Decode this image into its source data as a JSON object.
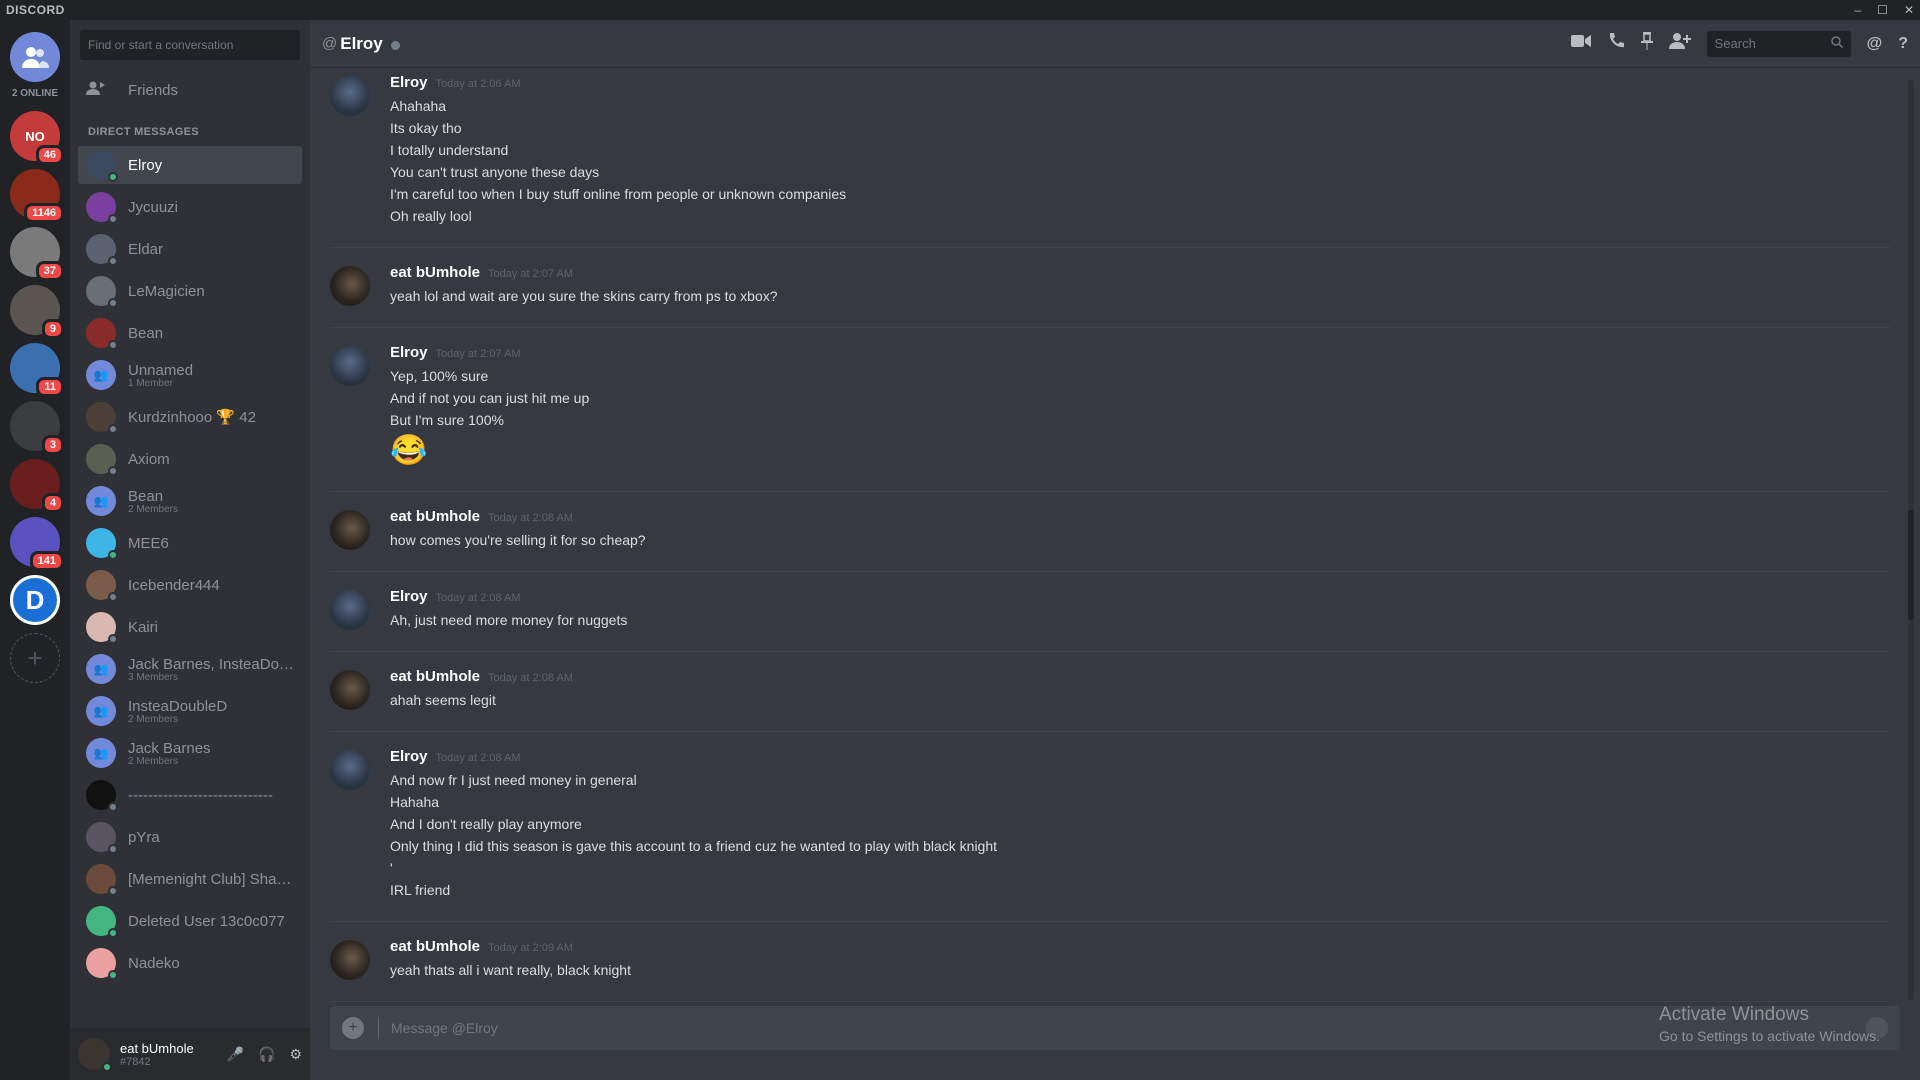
{
  "app": {
    "brand": "DISCORD"
  },
  "window": {
    "minimize": "–",
    "maximize": "☐",
    "close": "✕"
  },
  "guilds": {
    "online_count": "2 ONLINE",
    "items": [
      {
        "name": "Say No To Soy",
        "initials": "NO",
        "badge": "46",
        "color": "#c43b3b"
      },
      {
        "name": "red server",
        "initials": "",
        "badge": "1146",
        "color": "#8a2a1a"
      },
      {
        "name": "grey server",
        "initials": "",
        "badge": "37",
        "color": "#7a7a7a"
      },
      {
        "name": "photo server",
        "initials": "",
        "badge": "9",
        "color": "#5a5550"
      },
      {
        "name": "blue shoe server",
        "initials": "",
        "badge": "11",
        "color": "#3a6fb0"
      },
      {
        "name": "dark server",
        "initials": "",
        "badge": "3",
        "color": "#3a3c40"
      },
      {
        "name": "red logo server",
        "initials": "",
        "badge": "4",
        "color": "#6a1e1e"
      },
      {
        "name": "purple server",
        "initials": "",
        "badge": "141",
        "color": "#5a52c0"
      },
      {
        "name": "D server",
        "initials": "D",
        "badge": "",
        "color": "#1a6fd6"
      }
    ],
    "add_label": "+"
  },
  "dm_sidebar": {
    "search_placeholder": "Find or start a conversation",
    "friends_label": "Friends",
    "section_title": "DIRECT MESSAGES",
    "items": [
      {
        "name": "Elroy",
        "sub": "",
        "active": true,
        "color": "#3b4a5e"
      },
      {
        "name": "Jycuuzi",
        "sub": "",
        "active": false,
        "color": "#7b3fa0"
      },
      {
        "name": "Eldar",
        "sub": "",
        "active": false,
        "color": "#5b6170"
      },
      {
        "name": "LeMagicien",
        "sub": "",
        "active": false,
        "color": "#6a6e75"
      },
      {
        "name": "Bean",
        "sub": "",
        "active": false,
        "color": "#8a2b2b"
      },
      {
        "name": "Unnamed",
        "sub": "1 Member",
        "active": false,
        "color": "#7289da"
      },
      {
        "name": "Kurdzinhooo 🏆 42",
        "sub": "",
        "active": false,
        "color": "#4a4038"
      },
      {
        "name": "Axiom",
        "sub": "",
        "active": false,
        "color": "#5a5f52"
      },
      {
        "name": "Bean",
        "sub": "2 Members",
        "active": false,
        "color": "#7289da"
      },
      {
        "name": "MEE6",
        "sub": "",
        "active": false,
        "color": "#3fb5e6"
      },
      {
        "name": "Icebender444",
        "sub": "",
        "active": false,
        "color": "#7a5a48"
      },
      {
        "name": "Kairi",
        "sub": "",
        "active": false,
        "color": "#d8b8b0"
      },
      {
        "name": "Jack Barnes, InsteaDoub...",
        "sub": "3 Members",
        "active": false,
        "color": "#7289da"
      },
      {
        "name": "InsteaDoubleD",
        "sub": "2 Members",
        "active": false,
        "color": "#7289da"
      },
      {
        "name": "Jack Barnes",
        "sub": "2 Members",
        "active": false,
        "color": "#7289da"
      },
      {
        "name": "-----------------------------",
        "sub": "",
        "active": false,
        "color": "#111111"
      },
      {
        "name": "pYra",
        "sub": "",
        "active": false,
        "color": "#5a5560"
      },
      {
        "name": "[Memenight Club] Shai ...",
        "sub": "",
        "active": false,
        "color": "#6a4a3a"
      },
      {
        "name": "Deleted User 13c0c077",
        "sub": "",
        "active": false,
        "color": "#43b581"
      },
      {
        "name": "Nadeko",
        "sub": "",
        "active": false,
        "color": "#e8a0a0"
      }
    ]
  },
  "user_panel": {
    "username": "eat bUmhole",
    "discriminator": "#7842",
    "mic": "🎤",
    "headset": "🎧",
    "settings": "⚙"
  },
  "chat": {
    "at": "@",
    "title": "Elroy",
    "search_placeholder": "Search",
    "icons": {
      "video": "video-call-icon",
      "call": "voice-call-icon",
      "pin": "pin-icon",
      "add_user": "add-friend-icon",
      "mention": "@",
      "help": "?"
    },
    "messages": [
      {
        "author": "Elroy",
        "avatar": "elroy",
        "time": "Today at 2:06 AM",
        "lines": [
          "Ahahaha",
          "Its okay tho",
          "I totally understand",
          "You can't trust anyone these days",
          "I'm careful too when I buy stuff online from people or unknown companies",
          "Oh really lool"
        ]
      },
      {
        "author": "eat bUmhole",
        "avatar": "eat",
        "time": "Today at 2:07 AM",
        "lines": [
          "yeah lol and wait are you sure the skins carry from ps to xbox?"
        ]
      },
      {
        "author": "Elroy",
        "avatar": "elroy",
        "time": "Today at 2:07 AM",
        "lines": [
          "Yep, 100% sure",
          "And if not you can just hit me up",
          "But I'm sure 100%"
        ],
        "emoji": "😂"
      },
      {
        "author": "eat bUmhole",
        "avatar": "eat",
        "time": "Today at 2:08 AM",
        "lines": [
          "how comes you're selling it for so cheap?"
        ]
      },
      {
        "author": "Elroy",
        "avatar": "elroy",
        "time": "Today at 2:08 AM",
        "lines": [
          "Ah, just need more money for nuggets"
        ]
      },
      {
        "author": "eat bUmhole",
        "avatar": "eat",
        "time": "Today at 2:08 AM",
        "lines": [
          "ahah seems legit"
        ]
      },
      {
        "author": "Elroy",
        "avatar": "elroy",
        "time": "Today at 2:08 AM",
        "lines": [
          "And now fr I just need money in general",
          "Hahaha",
          "And I don't really play anymore",
          "Only thing I did this season is gave this account to a friend cuz he wanted to play with black knight",
          "'",
          "IRL friend"
        ]
      },
      {
        "author": "eat bUmhole",
        "avatar": "eat",
        "time": "Today at 2:09 AM",
        "lines": [
          "yeah thats all i want really, black knight"
        ]
      }
    ],
    "composer_placeholder": "Message @Elroy"
  },
  "watermark": {
    "line1": "Activate Windows",
    "line2": "Go to Settings to activate Windows."
  },
  "colors": {
    "accent": "#7289da",
    "online": "#43b581",
    "offline": "#747f8d",
    "badge": "#f04747"
  }
}
